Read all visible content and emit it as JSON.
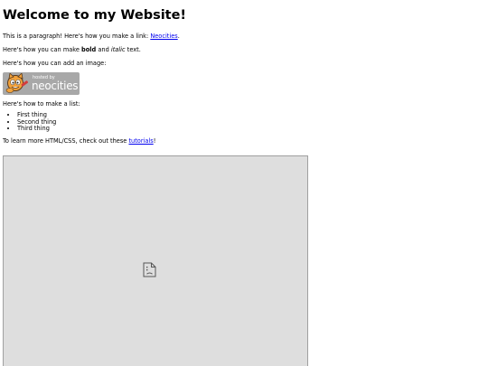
{
  "heading": "Welcome to my Website!",
  "paragraph1": {
    "text": "This is a paragraph! Here's how you make a link: ",
    "link": "Neocities",
    "end": "."
  },
  "paragraph2": {
    "pre": "Here's how you can make ",
    "bold": "bold",
    "mid": " and ",
    "italic": "italic",
    "post": " text."
  },
  "paragraph3": "Here's how you can add an image:",
  "badge": {
    "hosted": "hosted by",
    "brand": "neocities",
    "icon": "neocities-cat-icon"
  },
  "paragraph4": "Here's how to make a list:",
  "list": [
    "First thing",
    "Second thing",
    "Third thing"
  ],
  "paragraph5": {
    "pre": "To learn more HTML/CSS, check out these ",
    "link": "tutorials",
    "end": "!"
  },
  "iframe": {
    "icon": "broken-frame-icon"
  },
  "colors": {
    "link": "#0000ee",
    "badge_bg": "#a8a8a8",
    "frame_bg": "#dedede"
  }
}
